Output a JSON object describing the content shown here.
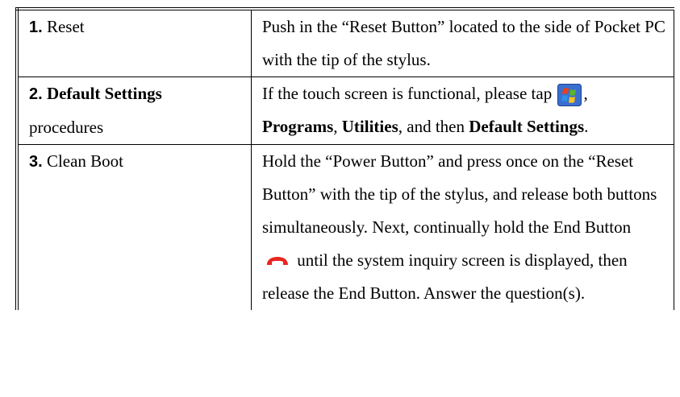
{
  "rows": [
    {
      "num": "1.",
      "title": "Reset",
      "desc": "Push in the “Reset Button” located to the side of Pocket PC with the tip of the stylus."
    },
    {
      "num": "2.",
      "title_bold": "Default Settings",
      "title_line2": "procedures",
      "desc_pre": "If the touch screen is functional, please tap",
      "desc_sep1": ",",
      "b1": "Programs",
      "sep2": ", ",
      "b2": "Utilities",
      "sep3": ", and then ",
      "b3": "Default Settings",
      "end": "."
    },
    {
      "num": "3.",
      "title": "Clean Boot",
      "desc_pre": "Hold the “Power Button” and press once on the “Reset Button” with the tip of the stylus, and release both buttons simultaneously. Next, continually hold the End Button",
      "desc_post": "until the system inquiry screen is displayed, then release the End Button. Answer the question(s)."
    }
  ],
  "icons": {
    "start": "windows-start-icon",
    "end": "end-button-icon",
    "end_color": "#e8261f"
  }
}
